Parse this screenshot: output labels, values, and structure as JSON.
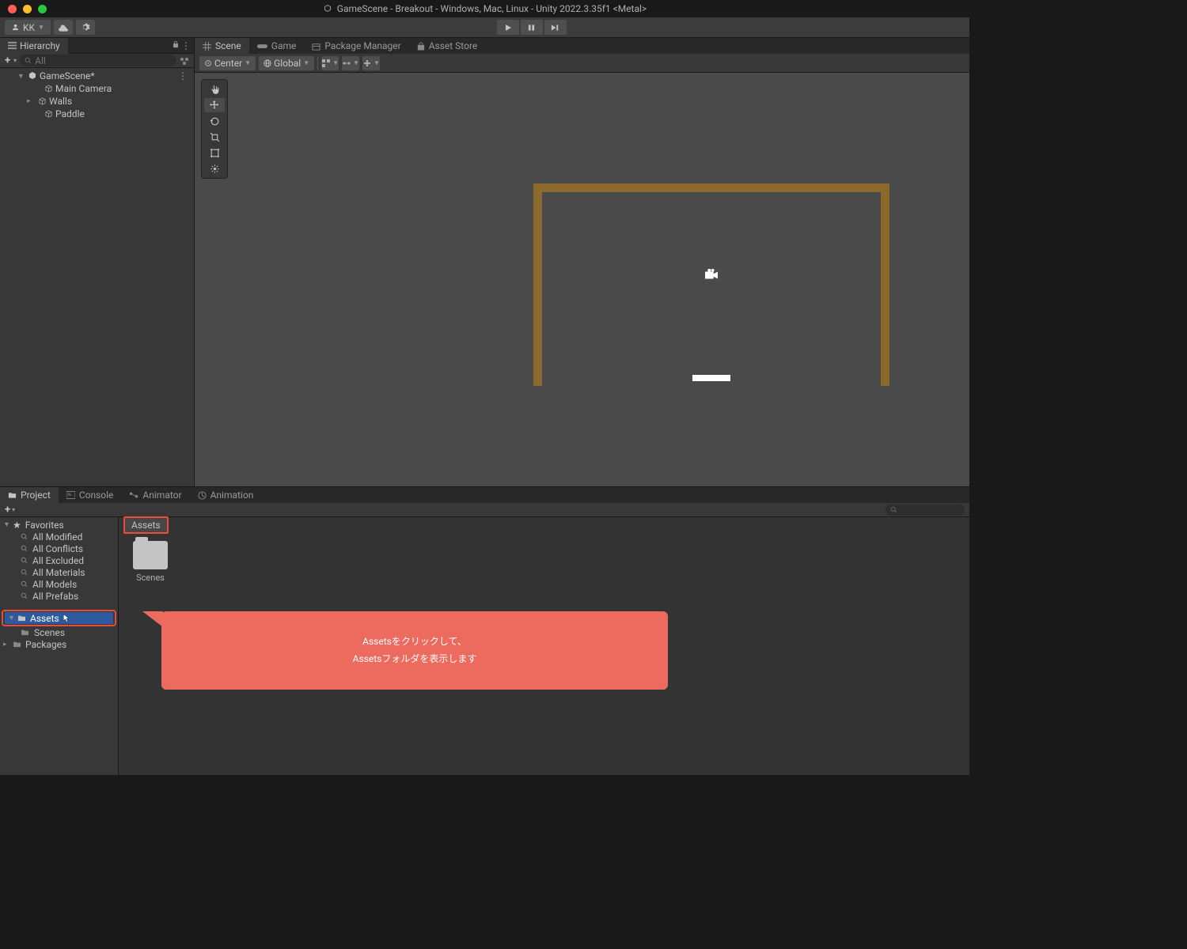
{
  "titlebar": {
    "title": "GameScene - Breakout - Windows, Mac, Linux - Unity 2022.3.35f1 <Metal>"
  },
  "toolbar": {
    "account": "KK"
  },
  "hierarchy": {
    "tabLabel": "Hierarchy",
    "searchPlaceholder": "All",
    "items": [
      {
        "label": "GameScene*",
        "indent": 0,
        "icon": "unity",
        "arrow": "▼"
      },
      {
        "label": "Main Camera",
        "indent": 1,
        "icon": "cube",
        "arrow": ""
      },
      {
        "label": "Walls",
        "indent": 1,
        "icon": "cube",
        "arrow": "▸"
      },
      {
        "label": "Paddle",
        "indent": 1,
        "icon": "cube",
        "arrow": ""
      }
    ]
  },
  "sceneTabs": [
    {
      "label": "Scene",
      "icon": "grid",
      "active": true
    },
    {
      "label": "Game",
      "icon": "gamepad",
      "active": false
    },
    {
      "label": "Package Manager",
      "icon": "package",
      "active": false
    },
    {
      "label": "Asset Store",
      "icon": "bag",
      "active": false
    }
  ],
  "sceneToolbar": {
    "pivot": "Center",
    "space": "Global"
  },
  "bottomTabs": [
    {
      "label": "Project",
      "icon": "folder",
      "active": true
    },
    {
      "label": "Console",
      "icon": "console",
      "active": false
    },
    {
      "label": "Animator",
      "icon": "animator",
      "active": false
    },
    {
      "label": "Animation",
      "icon": "animation",
      "active": false
    }
  ],
  "projectTree": {
    "favoritesLabel": "Favorites",
    "favorites": [
      "All Modified",
      "All Conflicts",
      "All Excluded",
      "All Materials",
      "All Models",
      "All Prefabs"
    ],
    "assetsLabel": "Assets",
    "assetsChildren": [
      "Scenes"
    ],
    "packagesLabel": "Packages"
  },
  "breadcrumb": {
    "label": "Assets"
  },
  "folders": [
    {
      "label": "Scenes"
    }
  ],
  "callout": {
    "line1": "Assetsをクリックして、",
    "line2": "Assetsフォルダを表示します"
  }
}
